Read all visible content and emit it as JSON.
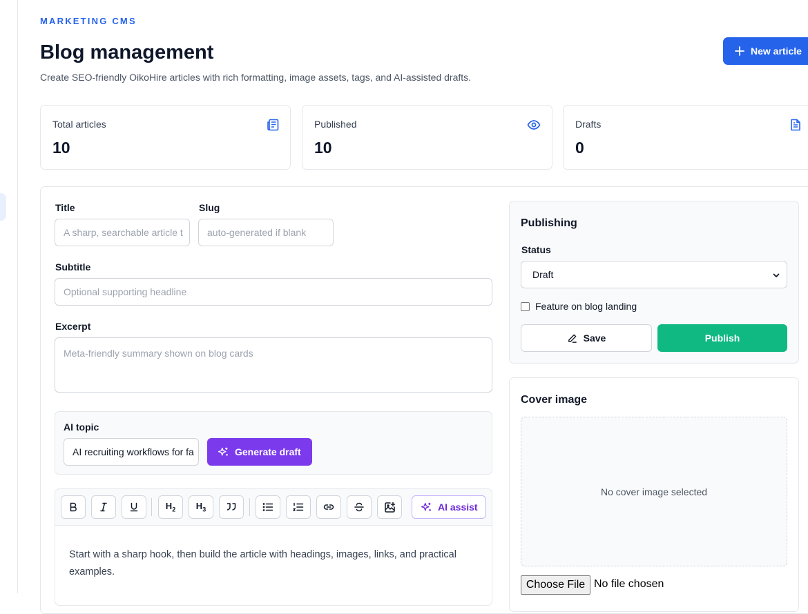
{
  "header": {
    "eyebrow": "MARKETING CMS",
    "title": "Blog management",
    "subtitle": "Create SEO-friendly OikoHire articles with rich formatting, image assets, tags, and AI-assisted drafts.",
    "new_button": "New article"
  },
  "stats": [
    {
      "label": "Total articles",
      "value": "10",
      "icon": "newspaper-icon"
    },
    {
      "label": "Published",
      "value": "10",
      "icon": "eye-icon"
    },
    {
      "label": "Drafts",
      "value": "0",
      "icon": "file-text-icon"
    }
  ],
  "form": {
    "title_label": "Title",
    "title_placeholder": "A sharp, searchable article t",
    "slug_label": "Slug",
    "slug_placeholder": "auto-generated if blank",
    "subtitle_label": "Subtitle",
    "subtitle_placeholder": "Optional supporting headline",
    "excerpt_label": "Excerpt",
    "excerpt_placeholder": "Meta-friendly summary shown on blog cards",
    "ai_topic_label": "AI topic",
    "ai_topic_value": "AI recruiting workflows for fa",
    "generate_button": "Generate draft"
  },
  "editor": {
    "toolbar": [
      "B",
      "I",
      "U",
      "H2",
      "H3",
      "quote",
      "bullet-list",
      "numbered-list",
      "link",
      "strikethrough",
      "image"
    ],
    "ai_assist": "AI assist",
    "body_placeholder": "Start with a sharp hook, then build the article with headings, images, links, and practical examples."
  },
  "publishing": {
    "title": "Publishing",
    "status_label": "Status",
    "status_value": "Draft",
    "feature_label": "Feature on blog landing",
    "feature_checked": false,
    "save_button": "Save",
    "publish_button": "Publish"
  },
  "cover": {
    "title": "Cover image",
    "empty_text": "No cover image selected",
    "file_button": "Choose File",
    "file_status": "No file chosen"
  },
  "colors": {
    "primary": "#2563eb",
    "ai_purple": "#7c3aed",
    "publish_green": "#10b981"
  }
}
